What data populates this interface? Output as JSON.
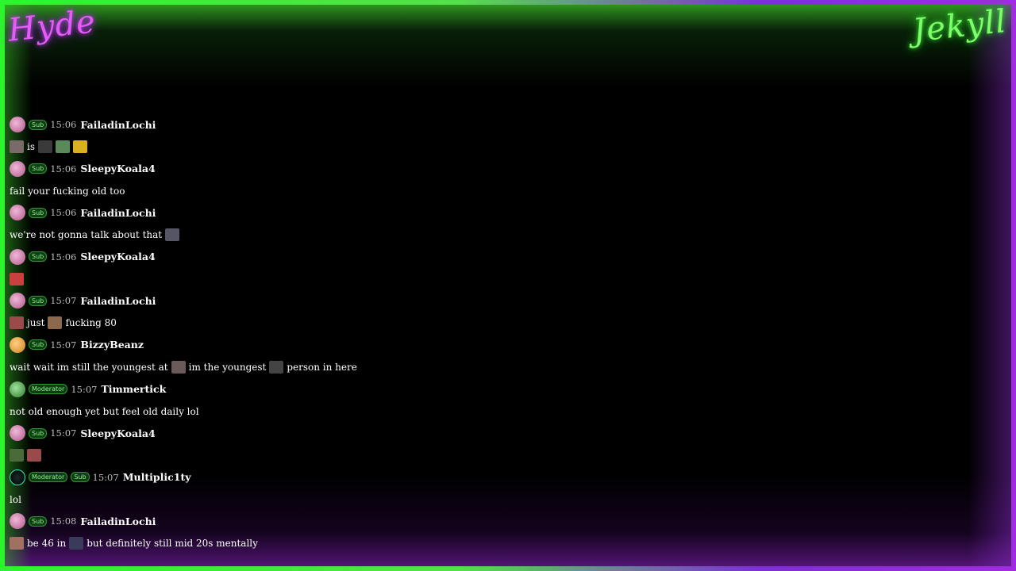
{
  "overlay": {
    "neon_left": "Hyde",
    "neon_right": "Jekyll"
  },
  "colors": {
    "frame_green": "#2df52d",
    "frame_purple": "#a12be0",
    "badge_green": "#8df28a"
  },
  "messages": [
    {
      "avatar": "pink-orb",
      "badges": [
        "Sub"
      ],
      "time": "15:06",
      "user": "FailadinLochi",
      "parts": [
        [
          "emote",
          "#7a6a6a"
        ],
        [
          "text",
          "is"
        ],
        [
          "emote",
          "#3a3a3a"
        ],
        [
          "emote",
          "#5a8a5a"
        ],
        [
          "emote",
          "#d8b020"
        ]
      ]
    },
    {
      "avatar": "pink-orb",
      "badges": [
        "Sub"
      ],
      "time": "15:06",
      "user": "SleepyKoala4",
      "parts": [
        [
          "text",
          "fail your fucking old too"
        ]
      ]
    },
    {
      "avatar": "pink-orb",
      "badges": [
        "Sub"
      ],
      "time": "15:06",
      "user": "FailadinLochi",
      "parts": [
        [
          "text",
          "we're not gonna talk about that"
        ],
        [
          "emote",
          "#555566"
        ]
      ]
    },
    {
      "avatar": "pink-orb",
      "badges": [
        "Sub"
      ],
      "time": "15:06",
      "user": "SleepyKoala4",
      "parts": [
        [
          "emote",
          "#c84040"
        ]
      ]
    },
    {
      "avatar": "pink-orb",
      "badges": [
        "Sub"
      ],
      "time": "15:07",
      "user": "FailadinLochi",
      "parts": [
        [
          "emote",
          "#9a4a4a"
        ],
        [
          "text",
          "just"
        ],
        [
          "emote",
          "#8a6a4a"
        ],
        [
          "text",
          "fucking 80"
        ]
      ]
    },
    {
      "avatar": "orange-orb",
      "badges": [
        "Sub"
      ],
      "time": "15:07",
      "user": "BizzyBeanz",
      "parts": [
        [
          "text",
          "wait wait im still the youngest at"
        ],
        [
          "emote",
          "#6a5a5a"
        ],
        [
          "text",
          "im the youngest"
        ],
        [
          "emote",
          "#444444"
        ],
        [
          "text",
          "person in here"
        ]
      ]
    },
    {
      "avatar": "green-face",
      "badges": [
        "Moderator"
      ],
      "time": "15:07",
      "user": "Timmertick",
      "parts": [
        [
          "text",
          "not old enough yet but feel old daily lol"
        ]
      ]
    },
    {
      "avatar": "pink-orb",
      "badges": [
        "Sub"
      ],
      "time": "15:07",
      "user": "SleepyKoala4",
      "parts": [
        [
          "emote",
          "#4a6a3a"
        ],
        [
          "emote",
          "#9a4a4a"
        ]
      ]
    },
    {
      "avatar": "dark-orb",
      "badges": [
        "Moderator",
        "Sub"
      ],
      "time": "15:07",
      "user": "Multiplic1ty",
      "parts": [
        [
          "text",
          "lol"
        ]
      ]
    },
    {
      "avatar": "pink-orb",
      "badges": [
        "Sub"
      ],
      "time": "15:08",
      "user": "FailadinLochi",
      "parts": [
        [
          "emote",
          "#a07060"
        ],
        [
          "text",
          "be 46 in"
        ],
        [
          "emote",
          "#3a3a5a"
        ],
        [
          "text",
          "but definitely still mid 20s mentally"
        ]
      ]
    }
  ]
}
